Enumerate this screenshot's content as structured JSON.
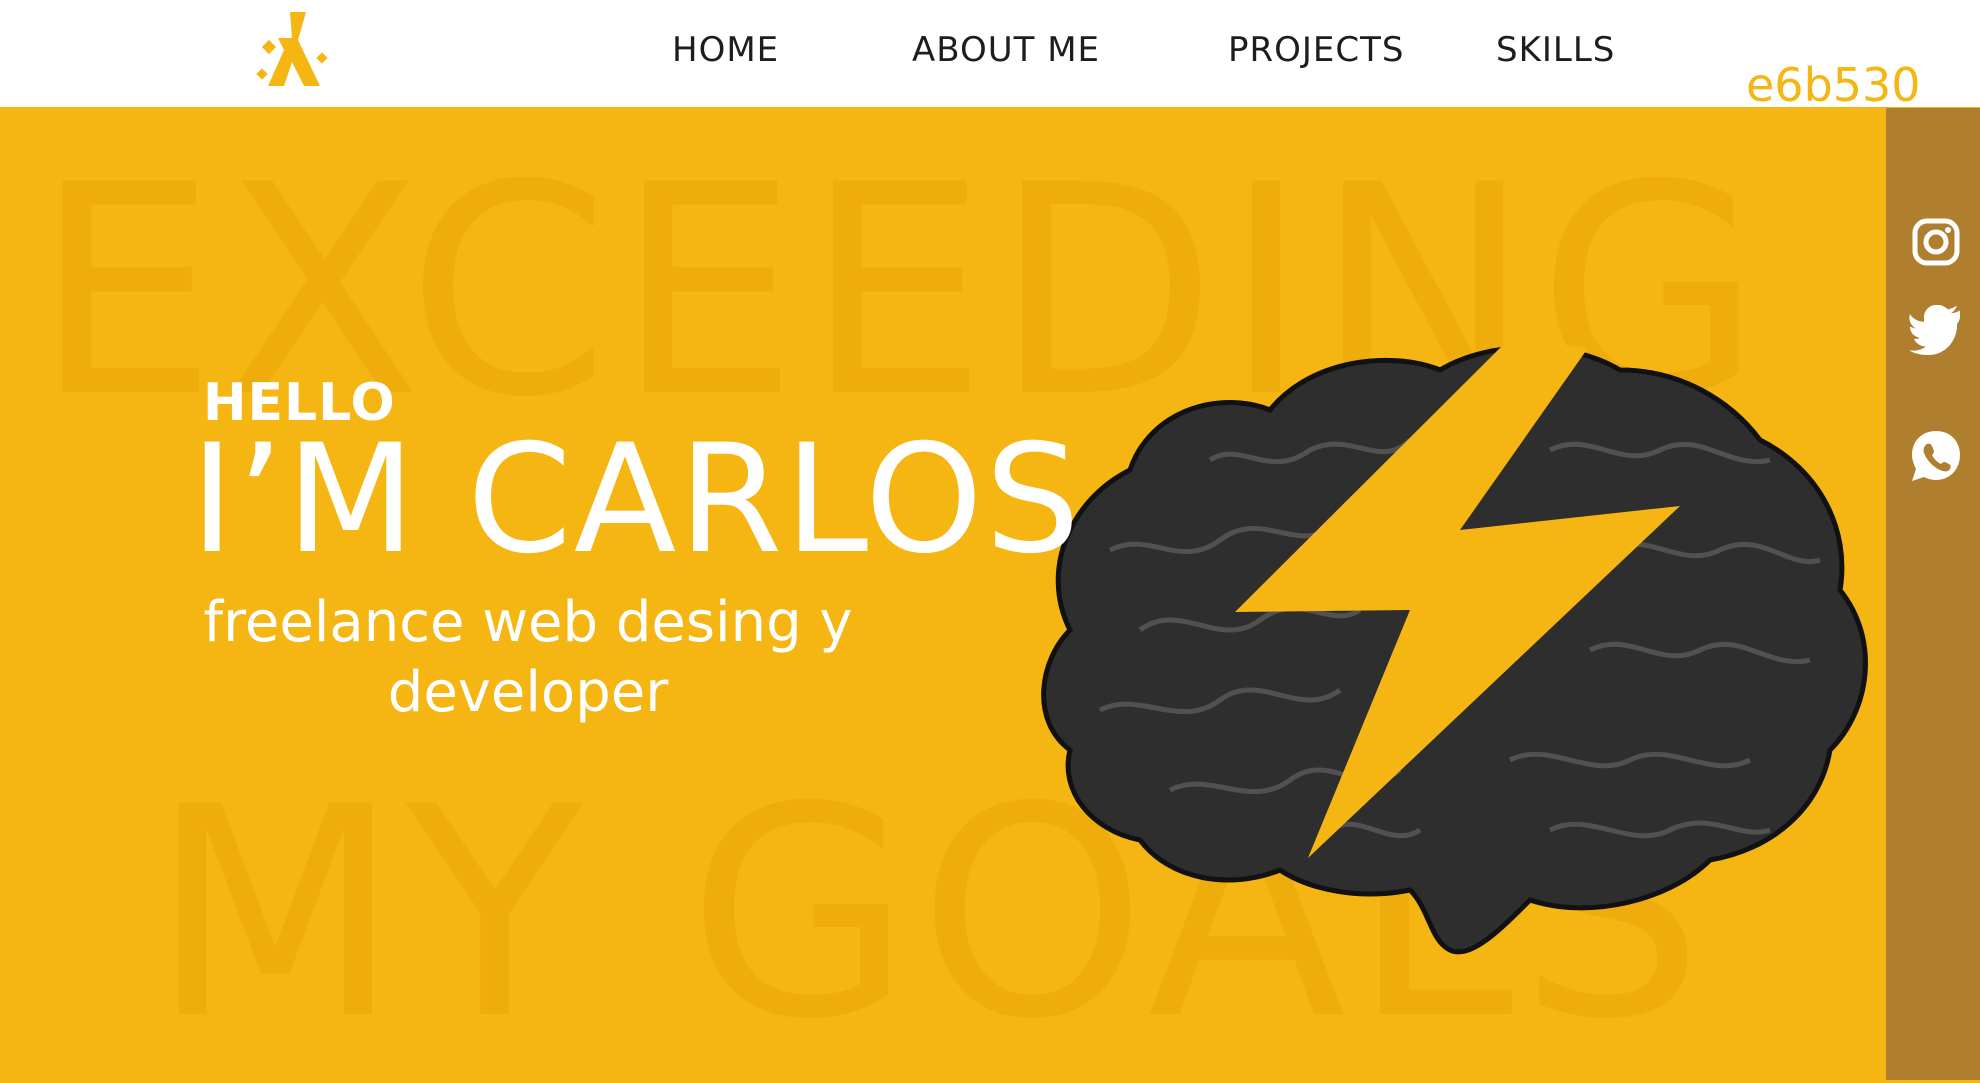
{
  "header": {
    "nav": [
      "HOME",
      "ABOUT ME",
      "PROJECTS",
      "SKILLS"
    ],
    "hex_label": "e6b530"
  },
  "watermark": {
    "line1": "EXCEEDING",
    "line2": "MY GOALS"
  },
  "hero": {
    "hello": "HELLO",
    "name": "I’M CARLOS",
    "subtitle_line1": "freelance web desing y",
    "subtitle_line2": "developer"
  },
  "social": [
    "instagram-icon",
    "twitter-icon",
    "whatsapp-icon"
  ],
  "colors": {
    "accent": "#f5b613",
    "header_bg": "#ffffff",
    "side_strip": "#b07e2f",
    "brain": "#2e2e2e",
    "text_light": "#ffffff",
    "text_dark": "#1d1d1b"
  }
}
